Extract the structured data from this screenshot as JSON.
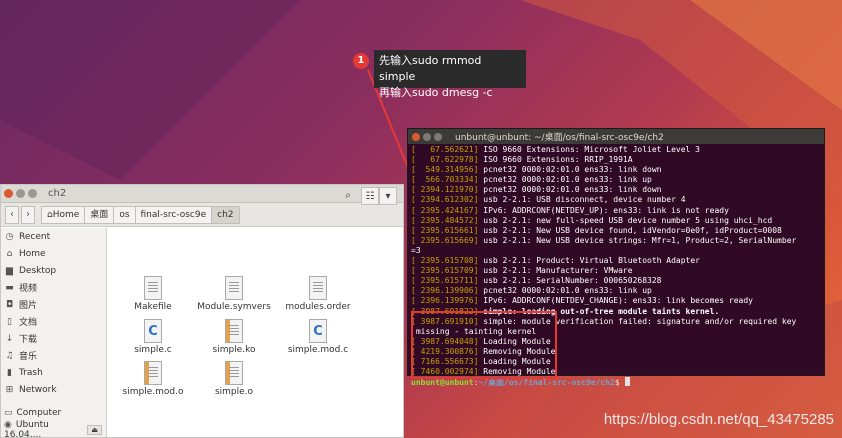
{
  "annotation": {
    "badge": "1",
    "line1": "先输入sudo rmmod simple",
    "line2": "再输入sudo dmesg -c"
  },
  "file_manager": {
    "title": "ch2",
    "breadcrumb": [
      "Home",
      "桌面",
      "os",
      "final-src-osc9e",
      "ch2"
    ],
    "sidebar": [
      {
        "icon": "clock-icon",
        "glyph": "◷",
        "label": "Recent"
      },
      {
        "icon": "home-icon",
        "glyph": "⌂",
        "label": "Home"
      },
      {
        "icon": "desktop-icon",
        "glyph": "▆",
        "label": "Desktop"
      },
      {
        "icon": "video-icon",
        "glyph": "▬",
        "label": "视频"
      },
      {
        "icon": "picture-icon",
        "glyph": "◘",
        "label": "图片"
      },
      {
        "icon": "document-icon",
        "glyph": "▯",
        "label": "文档"
      },
      {
        "icon": "download-icon",
        "glyph": "↓",
        "label": "下载"
      },
      {
        "icon": "music-icon",
        "glyph": "♫",
        "label": "音乐"
      },
      {
        "icon": "trash-icon",
        "glyph": "▮",
        "label": "Trash"
      },
      {
        "icon": "network-icon",
        "glyph": "⊞",
        "label": "Network"
      }
    ],
    "devices": [
      {
        "icon": "computer-icon",
        "glyph": "▭",
        "label": "Computer"
      },
      {
        "icon": "disc-icon",
        "glyph": "◉",
        "label": "Ubuntu 16.04...."
      }
    ],
    "eject_glyph": "⏏",
    "files": [
      {
        "name": "Makefile",
        "kind": "text"
      },
      {
        "name": "Module.symvers",
        "kind": "text"
      },
      {
        "name": "modules.order",
        "kind": "text"
      },
      {
        "name": "simple.c",
        "kind": "c"
      },
      {
        "name": "simple.ko",
        "kind": "ko"
      },
      {
        "name": "simple.mod.c",
        "kind": "c"
      },
      {
        "name": "simple.mod.o",
        "kind": "ko"
      },
      {
        "name": "simple.o",
        "kind": "ko"
      }
    ]
  },
  "terminal": {
    "title": "unbunt@unbunt: ~/桌面/os/final-src-osc9e/ch2",
    "lines": [
      {
        "ts": "[   67.562621]",
        "msg": " ISO 9660 Extensions: Microsoft Joliet Level 3"
      },
      {
        "ts": "[   67.622978]",
        "msg": " ISO 9660 Extensions: RRIP_1991A"
      },
      {
        "ts": "[  549.314956]",
        "msg": " pcnet32 0000:02:01.0 ens33: link down"
      },
      {
        "ts": "[  566.703334]",
        "msg": " pcnet32 0000:02:01.0 ens33: link up"
      },
      {
        "ts": "[ 2394.121970]",
        "msg": " pcnet32 0000:02:01.0 ens33: link down"
      },
      {
        "ts": "[ 2394.612302]",
        "msg": " usb 2-2.1: USB disconnect, device number 4"
      },
      {
        "ts": "[ 2395.424167]",
        "msg": " IPv6: ADDRCONF(NETDEV_UP): ens33: link is not ready"
      },
      {
        "ts": "[ 2395.484572]",
        "msg": " usb 2-2.1: new full-speed USB device number 5 using uhci_hcd"
      },
      {
        "ts": "[ 2395.615661]",
        "msg": " usb 2-2.1: New USB device found, idVendor=0e0f, idProduct=0008"
      },
      {
        "ts": "[ 2395.615669]",
        "msg": " usb 2-2.1: New USB device strings: Mfr=1, Product=2, SerialNumber"
      },
      {
        "ts": "",
        "msg": "=3"
      },
      {
        "ts": "[ 2395.615708]",
        "msg": " usb 2-2.1: Product: Virtual Bluetooth Adapter"
      },
      {
        "ts": "[ 2395.615709]",
        "msg": " usb 2-2.1: Manufacturer: VMware"
      },
      {
        "ts": "[ 2395.615711]",
        "msg": " usb 2-2.1: SerialNumber: 000650268328"
      },
      {
        "ts": "[ 2396.139906]",
        "msg": " pcnet32 0000:02:01.0 ens33: link up"
      },
      {
        "ts": "[ 2396.139976]",
        "msg": " IPv6: ADDRCONF(NETDEV_CHANGE): ens33: link becomes ready"
      },
      {
        "ts": "[ 3987.691822]",
        "msg": " simple: loading out-of-tree module taints kernel.",
        "bold": true
      },
      {
        "ts": "[ 3987.691910]",
        "msg": " simple: module verification failed: signature and/or required key"
      },
      {
        "ts": "",
        "msg": " missing - tainting kernel"
      },
      {
        "ts": "[ 3987.694048]",
        "msg": " Loading Module"
      },
      {
        "ts": "[ 4219.300876]",
        "msg": " Removing Module"
      },
      {
        "ts": "[ 7166.556673]",
        "msg": " Loading Module"
      },
      {
        "ts": "[ 7460.002974]",
        "msg": " Removing Module"
      }
    ],
    "prompt_user": "unbunt@unbunt",
    "prompt_sep": ":",
    "prompt_path": "~/桌面/os/final-src-osc9e/ch2",
    "prompt_end": "$ "
  },
  "watermark": "https://blog.csdn.net/qq_43475285"
}
